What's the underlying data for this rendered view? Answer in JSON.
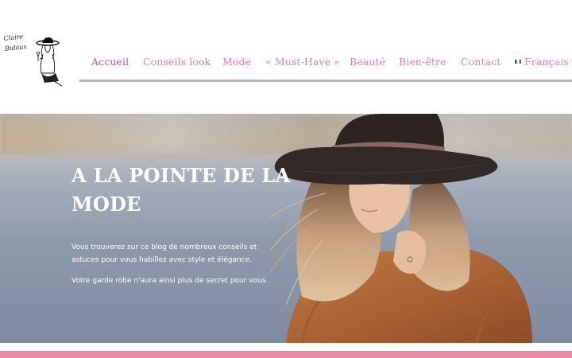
{
  "logo": {
    "text": "Claire\nBidaux"
  },
  "nav": {
    "items": [
      {
        "label": "Accueil",
        "active": true
      },
      {
        "label": "Conseils look",
        "active": false
      },
      {
        "label": "Mode",
        "active": false
      },
      {
        "label": "« Must-Have »",
        "active": false
      },
      {
        "label": "Beauté",
        "active": false
      },
      {
        "label": "Bien-être",
        "active": false
      },
      {
        "label": "Contact",
        "active": false
      }
    ],
    "language": {
      "label": "Français",
      "flag": "french-flag-icon"
    }
  },
  "hero": {
    "title": "A LA POINTE DE LA MODE",
    "paragraph1": "Vous trouverez sur ce blog de nombreux conseils et astuces pour vous habillez avec style et élégance.",
    "paragraph2": "Votre garde robe n'aura ainsi plus de secret pour vous."
  },
  "colors": {
    "nav_text": "#e07fab",
    "nav_active": "#b35aa0",
    "accent_bar": "#ef8aa6",
    "nav_underline": "#b5b5b5"
  }
}
